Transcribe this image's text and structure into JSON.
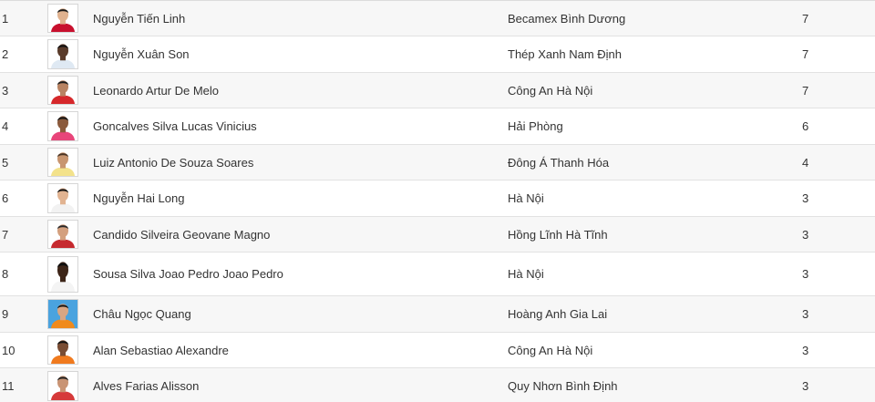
{
  "players": [
    {
      "rank": "1",
      "name": "Nguyễn Tiến Linh",
      "club": "Becamex Bình Dương",
      "goals": "7",
      "avatar": {
        "icon": "player-photo-icon",
        "shirt": "#c8102e",
        "bg": "#ffffff",
        "skin": "#e0b28f",
        "hair": "#1a1a1a"
      }
    },
    {
      "rank": "2",
      "name": "Nguyễn Xuân Son",
      "club": "Thép Xanh Nam Định",
      "goals": "7",
      "avatar": {
        "icon": "player-photo-icon",
        "shirt": "#dfe9f3",
        "bg": "#ffffff",
        "skin": "#5a3b2a",
        "hair": "#111111"
      }
    },
    {
      "rank": "3",
      "name": "Leonardo Artur De Melo",
      "club": "Công An Hà Nội",
      "goals": "7",
      "avatar": {
        "icon": "player-photo-icon",
        "shirt": "#d6282b",
        "bg": "#ffffff",
        "skin": "#b98362",
        "hair": "#1d1d1d"
      }
    },
    {
      "rank": "4",
      "name": "Goncalves Silva Lucas Vinicius",
      "club": "Hải Phòng",
      "goals": "6",
      "avatar": {
        "icon": "player-photo-icon",
        "shirt": "#e8457a",
        "bg": "#ffffff",
        "skin": "#8b5a3c",
        "hair": "#151515"
      }
    },
    {
      "rank": "5",
      "name": "Luiz Antonio De Souza Soares",
      "club": "Đông Á Thanh Hóa",
      "goals": "4",
      "avatar": {
        "icon": "player-photo-icon",
        "shirt": "#f3e28b",
        "bg": "#ffffff",
        "skin": "#c8956f",
        "hair": "#4a3424"
      }
    },
    {
      "rank": "6",
      "name": "Nguyễn Hai Long",
      "club": "Hà Nội",
      "goals": "3",
      "avatar": {
        "icon": "player-photo-icon",
        "shirt": "#f2f2f2",
        "bg": "#ffffff",
        "skin": "#e1b391",
        "hair": "#111111"
      }
    },
    {
      "rank": "7",
      "name": "Candido Silveira Geovane Magno",
      "club": "Hồng Lĩnh Hà Tĩnh",
      "goals": "3",
      "avatar": {
        "icon": "player-photo-icon",
        "shirt": "#c62a2f",
        "bg": "#ffffff",
        "skin": "#d4a07e",
        "hair": "#2a2a2a"
      }
    },
    {
      "rank": "8",
      "name": "Sousa Silva Joao Pedro Joao Pedro",
      "club": "Hà Nội",
      "goals": "3",
      "avatar": {
        "icon": "player-photo-icon",
        "shirt": "#f4f4f4",
        "bg": "#ffffff",
        "skin": "#3d2518",
        "hair": "#0e0e0e"
      }
    },
    {
      "rank": "9",
      "name": "Châu Ngọc Quang",
      "club": "Hoàng Anh Gia Lai",
      "goals": "3",
      "avatar": {
        "icon": "player-photo-icon",
        "shirt": "#f08a1c",
        "bg": "#4aa3df",
        "skin": "#d9a683",
        "hair": "#151515"
      }
    },
    {
      "rank": "10",
      "name": "Alan Sebastiao Alexandre",
      "club": "Công An Hà Nội",
      "goals": "3",
      "avatar": {
        "icon": "player-photo-icon",
        "shirt": "#f07a1e",
        "bg": "#ffffff",
        "skin": "#7a4d33",
        "hair": "#121212"
      }
    },
    {
      "rank": "11",
      "name": "Alves Farias Alisson",
      "club": "Quy Nhơn Bình Định",
      "goals": "3",
      "avatar": {
        "icon": "player-photo-icon",
        "shirt": "#d63a3a",
        "bg": "#ffffff",
        "skin": "#c99474",
        "hair": "#222222"
      }
    }
  ]
}
